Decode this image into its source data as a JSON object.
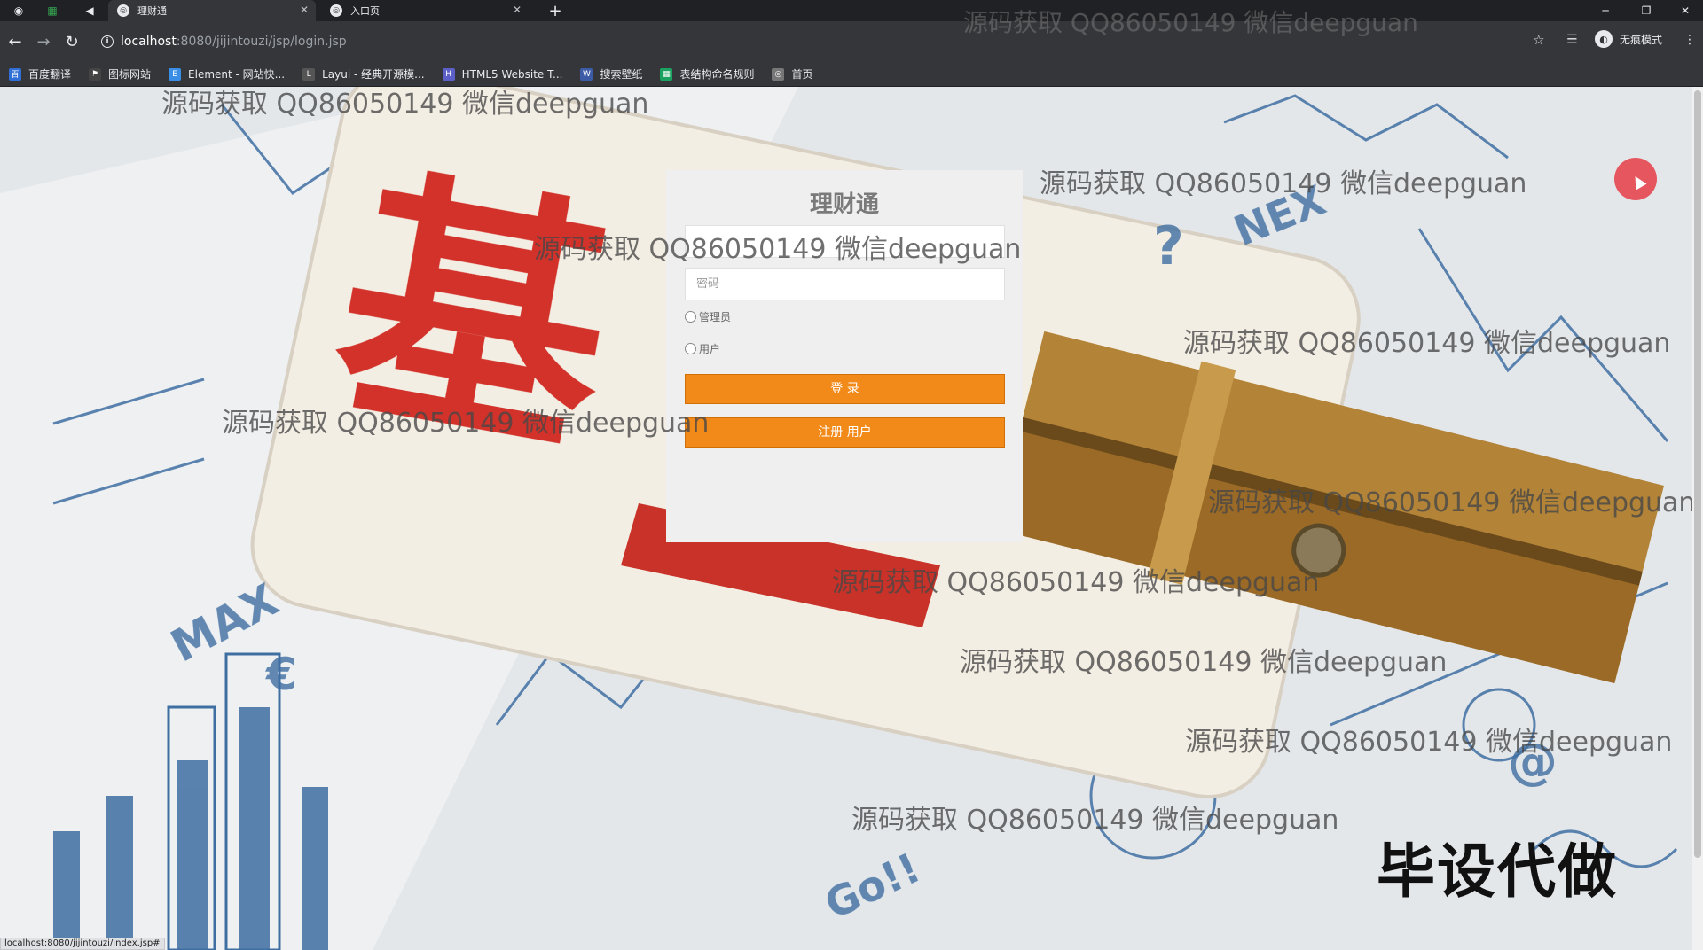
{
  "browser": {
    "tabs": [
      {
        "title": "理财通",
        "active": true
      },
      {
        "title": "入口页",
        "active": false
      }
    ],
    "url_host": "localhost",
    "url_path": ":8080/jijintouzi/jsp/login.jsp",
    "profile_label": "无痕模式",
    "bookmarks": [
      {
        "label": "百度翻译",
        "color": "#2f6fd6",
        "icon": "百"
      },
      {
        "label": "图标网站",
        "color": "#444444",
        "icon": "⚑"
      },
      {
        "label": "Element - 网站快...",
        "color": "#3a8ee6",
        "icon": "E"
      },
      {
        "label": "Layui - 经典开源模...",
        "color": "#555555",
        "icon": "L"
      },
      {
        "label": "HTML5 Website T...",
        "color": "#5b5fc7",
        "icon": "H"
      },
      {
        "label": "搜索壁纸",
        "color": "#3c5ca8",
        "icon": "W"
      },
      {
        "label": "表结构命名规则",
        "color": "#1aa260",
        "icon": "▦"
      },
      {
        "label": "首页",
        "color": "#777777",
        "icon": "◎"
      }
    ],
    "status_url": "localhost:8080/jijintouzi/index.jsp#"
  },
  "login": {
    "title": "理财通",
    "username_placeholder": "",
    "password_placeholder": "密码",
    "radio_admin": "管理员",
    "radio_user": "用户",
    "login_button": "登 录",
    "register_button": "注册 用户"
  },
  "background_text": {
    "big_char": "基"
  },
  "watermark_text": "源码获取 QQ86050149 微信deepguan",
  "promo_text": "毕设代做"
}
